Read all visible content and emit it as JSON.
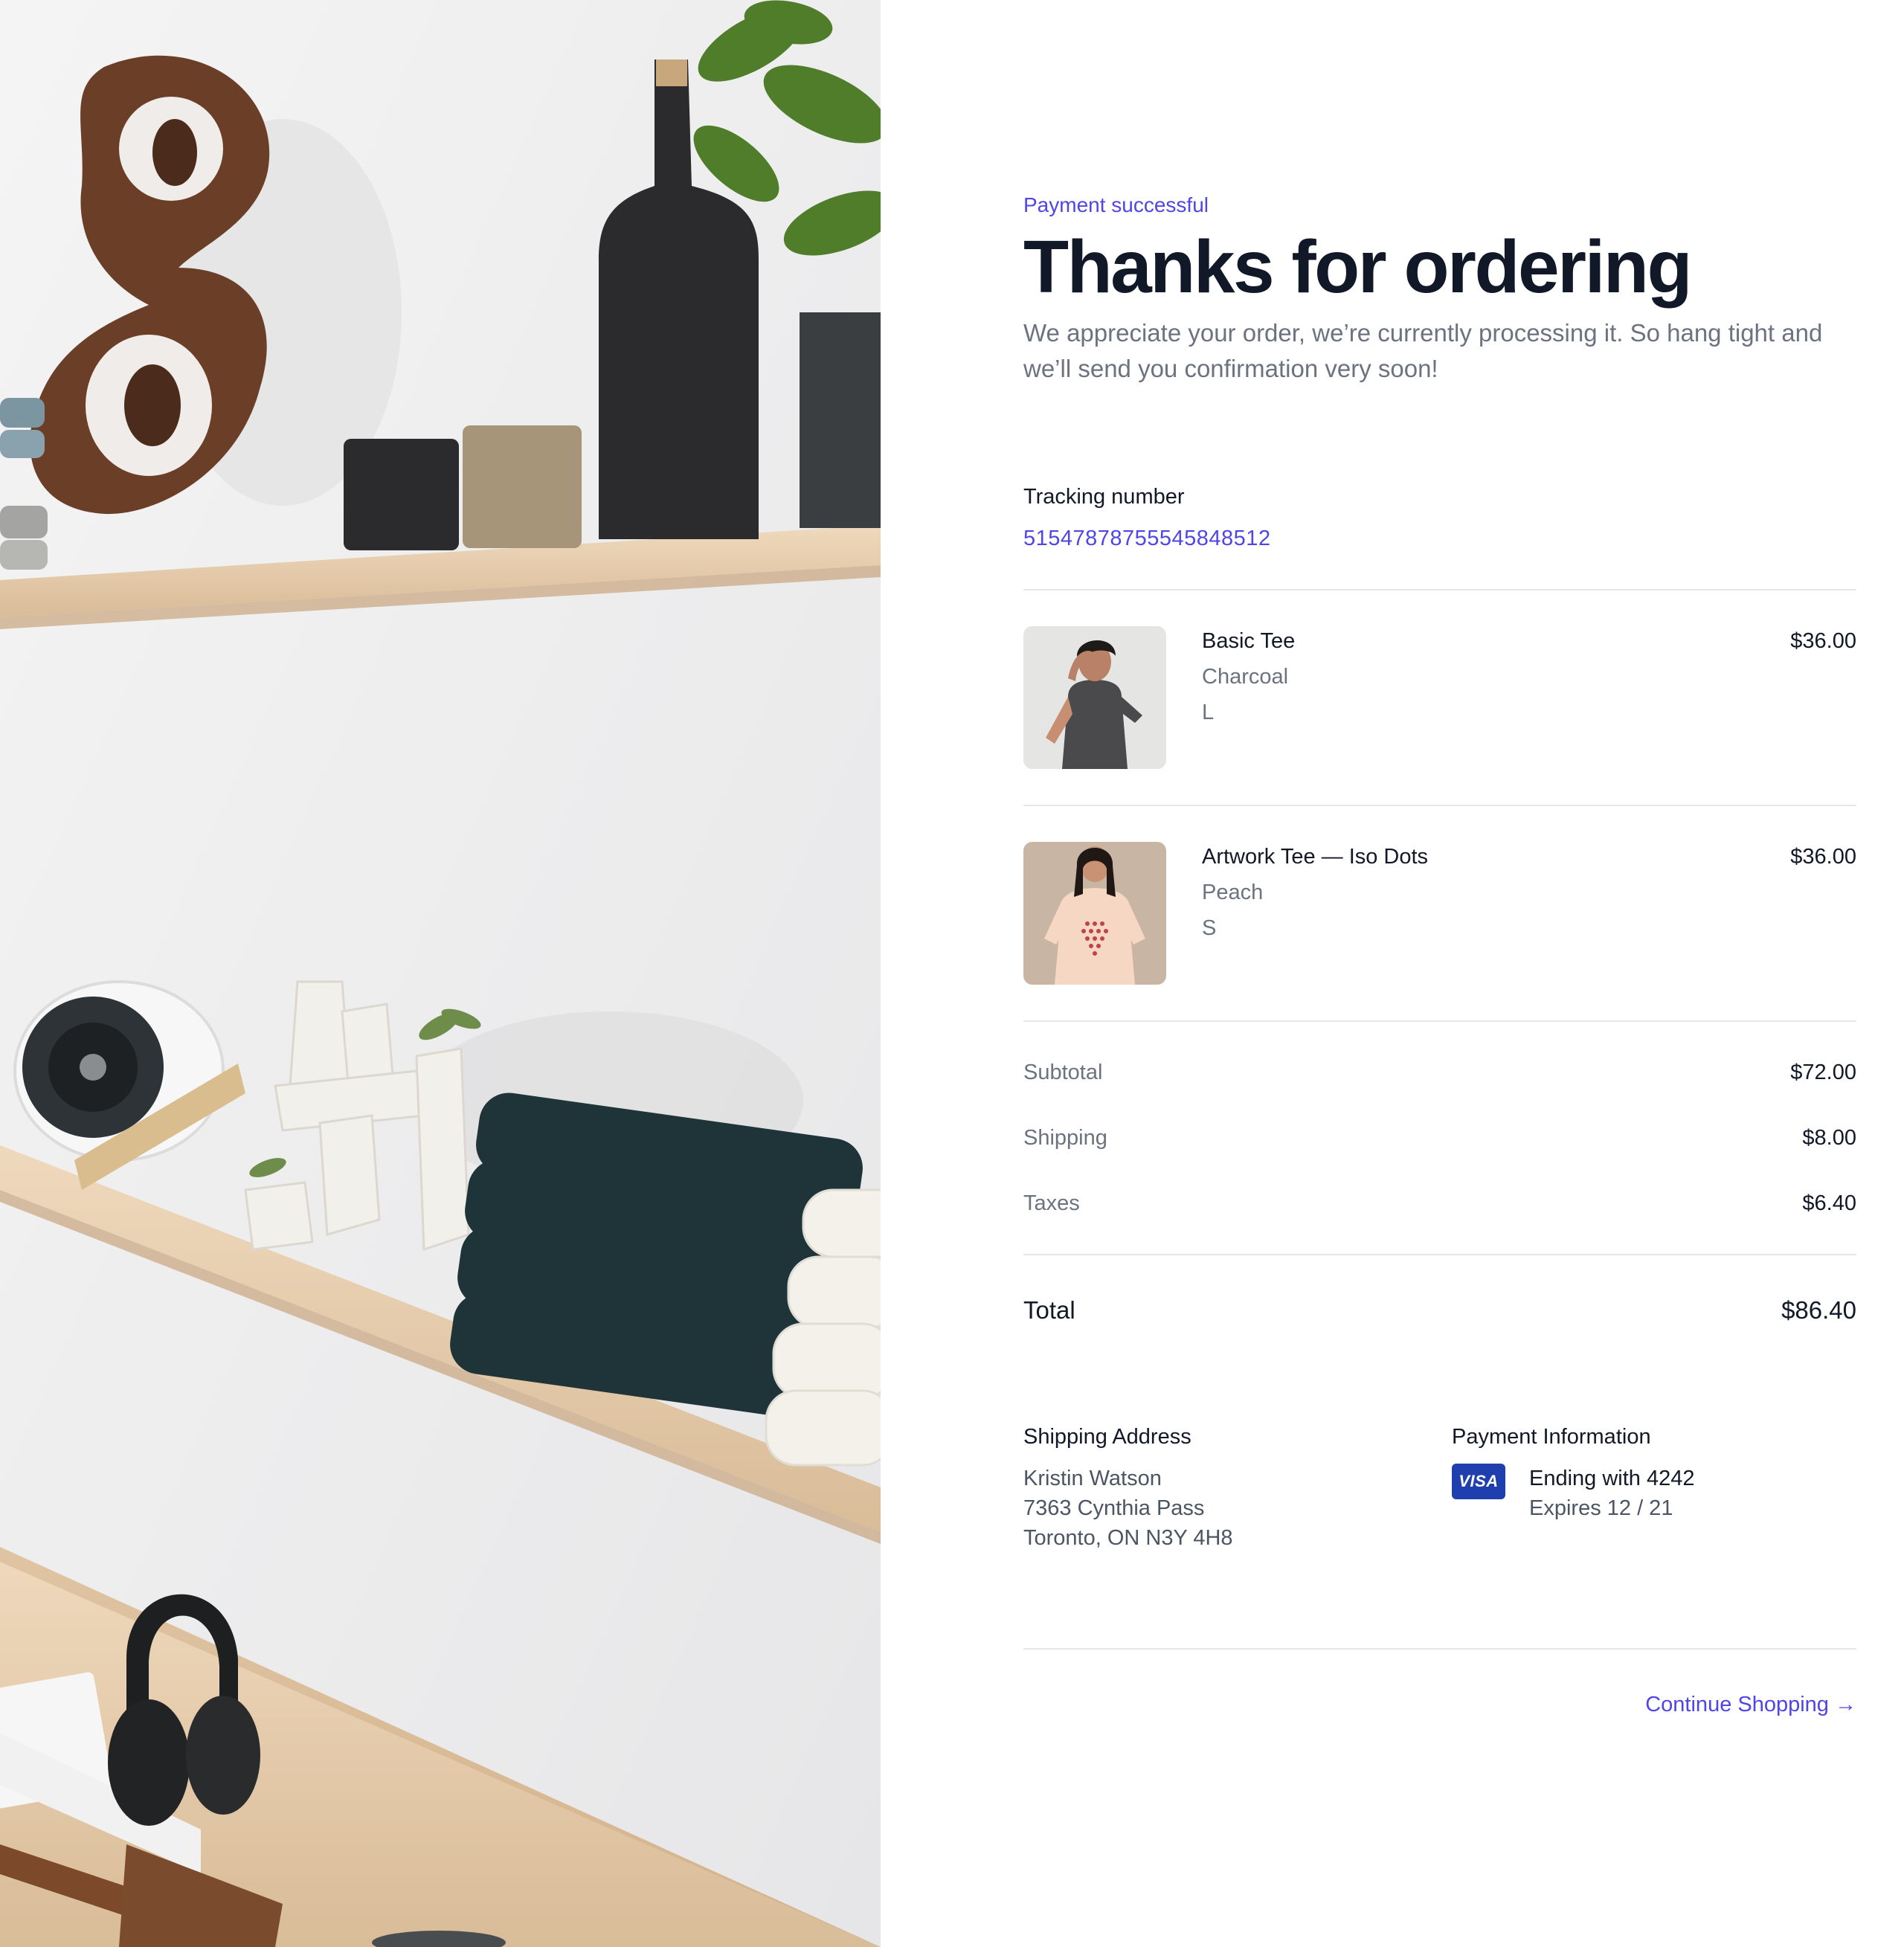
{
  "hero": {
    "image_description_icon": "shelf-photo-image"
  },
  "header": {
    "eyebrow": "Payment successful",
    "title": "Thanks for ordering",
    "intro": "We appreciate your order, we’re currently processing it. So hang tight and we’ll send you confirmation very soon!"
  },
  "tracking": {
    "label": "Tracking number",
    "number": "51547878755545848512"
  },
  "items": [
    {
      "name": "Basic Tee",
      "color": "Charcoal",
      "size": "L",
      "price": "$36.00"
    },
    {
      "name": "Artwork Tee — Iso Dots",
      "color": "Peach",
      "size": "S",
      "price": "$36.00"
    }
  ],
  "summary": {
    "subtotal_label": "Subtotal",
    "subtotal_value": "$72.00",
    "shipping_label": "Shipping",
    "shipping_value": "$8.00",
    "taxes_label": "Taxes",
    "taxes_value": "$6.40",
    "total_label": "Total",
    "total_value": "$86.40"
  },
  "shipping_address": {
    "title": "Shipping Address",
    "lines": [
      "Kristin Watson",
      "7363 Cynthia Pass",
      "Toronto, ON N3Y 4H8"
    ]
  },
  "payment": {
    "title": "Payment Information",
    "card_brand": "VISA",
    "ending": "Ending with 4242",
    "expires": "Expires 12 / 21"
  },
  "actions": {
    "continue_label": "Continue Shopping →"
  },
  "colors": {
    "accent": "#4f46e5",
    "heading": "#111827",
    "muted": "#6b7280",
    "visa": "#1f3fae"
  }
}
